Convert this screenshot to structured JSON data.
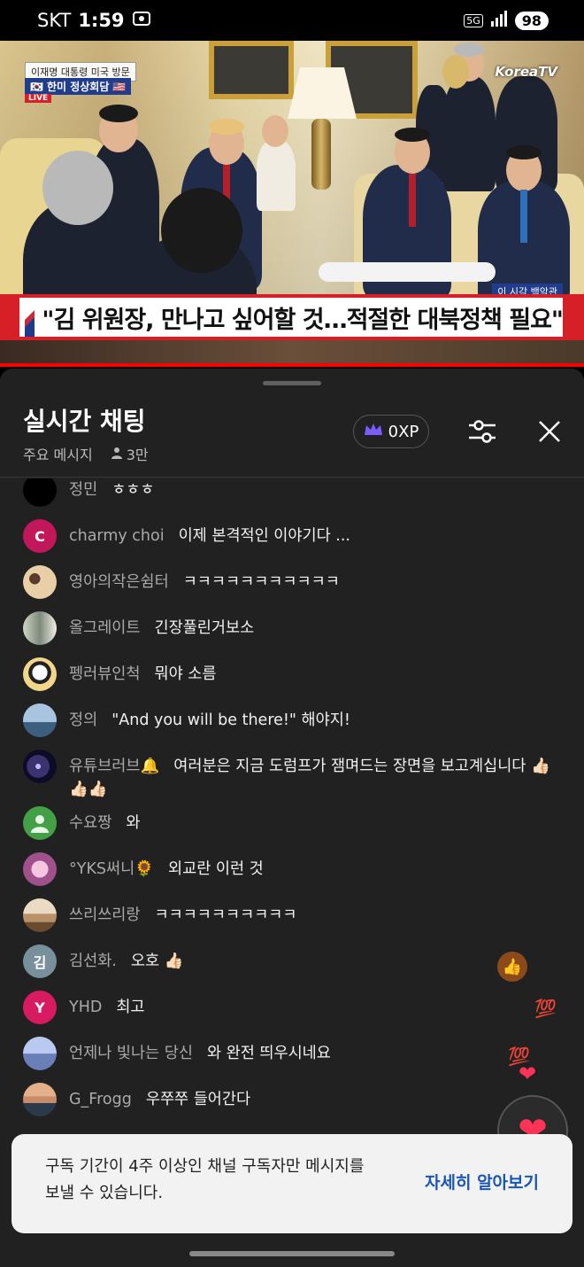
{
  "status_bar": {
    "carrier": "SKT",
    "time": "1:59",
    "network": "5G",
    "battery": "98"
  },
  "video": {
    "badge_line1": "이재명 대통령 미국 방문",
    "badge_line2": "한미 정상회담",
    "live": "LIVE",
    "channel": "KoreaTV",
    "corner_tag": "이 시각 백악관",
    "headline": "\"김 위원장, 만나고 싶어할 것…적절한 대북정책 필요\""
  },
  "chat": {
    "title": "실시간 채팅",
    "mode": "주요 메시지",
    "viewers": "3만",
    "xp": "0XP",
    "messages": [
      {
        "author": "정민",
        "text": "ㅎㅎㅎ",
        "avatar_color": "#000000",
        "initial": ""
      },
      {
        "author": "charmy choi",
        "text": "이제 본격적인 이야기다 ...",
        "avatar_color": "#c2185b",
        "initial": "C"
      },
      {
        "author": "영아의작은쉼터",
        "text": "ㅋㅋㅋㅋㅋㅋㅋㅋㅋㅋㅋ",
        "avatar_color": "#d8c4a0",
        "initial": ""
      },
      {
        "author": "올그레이트",
        "text": "긴장풀린거보소",
        "avatar_color": "#7d8a7a",
        "initial": ""
      },
      {
        "author": "펭러뷰인척",
        "text": "뭐야 소름",
        "avatar_color": "#e9d08a",
        "initial": ""
      },
      {
        "author": "정의",
        "text": "\"And you will be there!\" 해야지!",
        "avatar_color": "#6a90b8",
        "initial": ""
      },
      {
        "author": "유튜브러브🔔",
        "text": "여러분은 지금 도럼프가 잼며드는 장면을 보고계십니다 👍🏻👍🏻👍🏻",
        "avatar_color": "#2a2550",
        "initial": ""
      },
      {
        "author": "수요짱",
        "text": "와",
        "avatar_color": "#43a047",
        "initial": ""
      },
      {
        "author": "°YKS써니🌻",
        "text": "외교란 이런 것",
        "avatar_color": "#c77fb0",
        "initial": ""
      },
      {
        "author": "쓰리쓰리랑",
        "text": "ㅋㅋㅋㅋㅋㅋㅋㅋㅋㅋ",
        "avatar_color": "#b8906a",
        "initial": ""
      },
      {
        "author": "김선화.",
        "text": "오호 👍🏻",
        "avatar_color": "#78909c",
        "initial": "김"
      },
      {
        "author": "YHD",
        "text": "최고",
        "avatar_color": "#d81b60",
        "initial": "Y"
      },
      {
        "author": "언제나 빛나는 당신",
        "text": "와 완전 띄우시네요",
        "avatar_color": "#6a7fb8",
        "initial": ""
      },
      {
        "author": "G_Frogg",
        "text": "우쭈쭈 들어간다",
        "avatar_color": "#c98a6a",
        "initial": ""
      }
    ],
    "reactions": {
      "thumb": "👍",
      "hundred": "💯",
      "heart": "❤"
    },
    "notice_text": "구독 기간이 4주 이상인 채널 구독자만 메시지를 보낼 수 있습니다.",
    "notice_link": "자세히 알아보기"
  }
}
